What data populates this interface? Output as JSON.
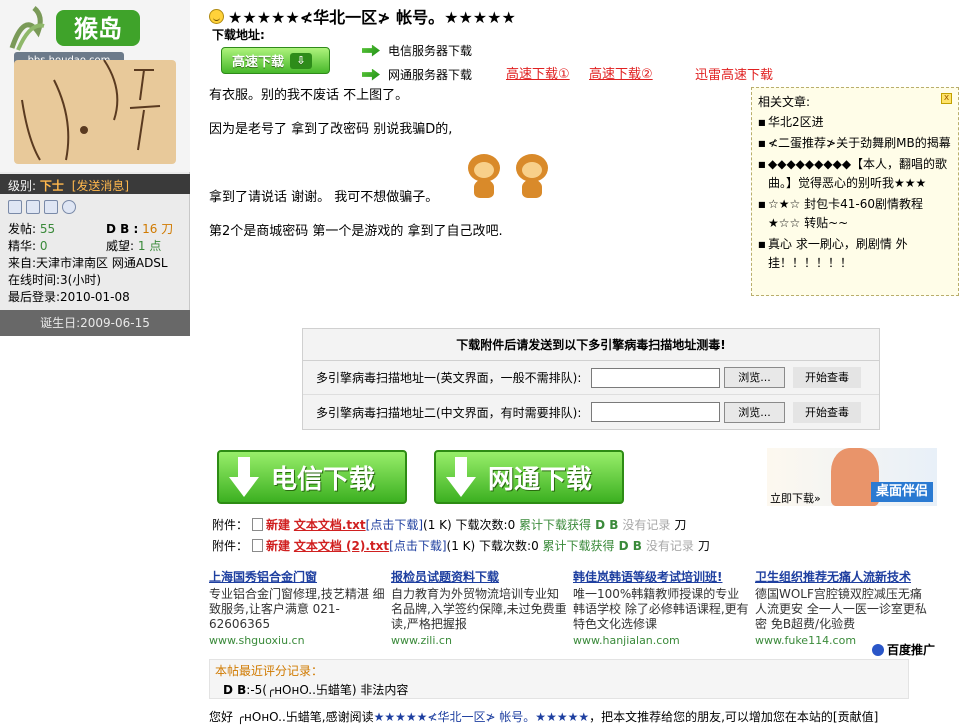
{
  "profile": {
    "logo_text": "猴岛",
    "logo_url": "bbs.houdao.com",
    "level_label": "级别:",
    "level_value": "下士",
    "send_msg": "[发送消息]",
    "posts_label": "发帖:",
    "posts_value": "55",
    "db_label": "D B :",
    "db_value": "16 刀",
    "elite_label": "精华:",
    "elite_value": "0",
    "prestige_label": "威望:",
    "prestige_value": "1 点",
    "from": "来自:天津市津南区 网通ADSL",
    "online": "在线时间:3(小时)",
    "last_login": "最后登录:2010-01-08",
    "birthday": "诞生日:2009-06-15"
  },
  "post": {
    "title": "★★★★★≮华北一区≯ 帐号。★★★★★",
    "download_label": "下载地址:",
    "fast_button": "高速下载",
    "telecom_server": "电信服务器下载",
    "netcom_server": "网通服务器下载",
    "fast_dl_1": "高速下载①",
    "fast_dl_2": "高速下载②",
    "xunlei": "迅雷高速下载",
    "lines": [
      "有衣服。别的我不废话  不上图了。",
      "因为是老号了  拿到了改密码  别说我骗D的,",
      "拿到了请说话  谢谢。  我可不想做骗子。",
      "第2个是商城密码  第一个是游戏的  拿到了自己改吧."
    ]
  },
  "related": {
    "title": "相关文章:",
    "close": "x",
    "items": [
      "华北2区进",
      "≮二蛋推荐≯关于劲舞刷MB的揭幕",
      "◆◆◆◆◆◆◆◆◆【本人，翻唱的歌曲。】觉得恶心的别听我★★★",
      "☆★☆ 封包卡41-60剧情教程★☆☆ 转贴~~",
      "真心  求一刷心，刷剧情  外挂！！！！！！"
    ]
  },
  "scan": {
    "header": "下载附件后请发送到以下多引擎病毒扫描地址测毒!",
    "row1_label": "多引擎病毒扫描地址一(英文界面，一般不需排队):",
    "row2_label": "多引擎病毒扫描地址二(中文界面，有时需要排队):",
    "browse": "浏览...",
    "check": "开始查毒"
  },
  "downloads": {
    "telecom": "电信下载",
    "netcom": "网通下载",
    "ad_cta": "立即下载»",
    "ad_brand": "桌面伴侣"
  },
  "attachments": [
    {
      "prefix": "附件：",
      "new": "新建",
      "name": "文本文档.txt",
      "click": "[点击下载]",
      "size": "(1 K)",
      "count": "下载次数:0",
      "acc": "累计下载获得",
      "db": "D B",
      "norec": "没有记录",
      "unit": "刀"
    },
    {
      "prefix": "附件：",
      "new": "新建",
      "name": "文本文档 (2).txt",
      "click": "[点击下载]",
      "size": "(1 K)",
      "count": "下载次数:0",
      "acc": "累计下载获得",
      "db": "D B",
      "norec": "没有记录",
      "unit": "刀"
    }
  ],
  "ads": [
    {
      "title": "上海国秀铝合金门窗",
      "desc": "专业铝合金门窗修理,技艺精湛  细致服务,让客户满意  021-62606365",
      "url": "www.shguoxiu.cn"
    },
    {
      "title": "报检员试题资料下载",
      "desc": "自力教育为外贸物流培训专业知名品牌,入学签约保障,未过免费重读,严格把握报",
      "url": "www.zili.cn"
    },
    {
      "title": "韩佳岚韩语等级考试培训班!",
      "desc": "唯一100%韩籍教师授课的专业韩语学校  除了必修韩语课程,更有特色文化选修课",
      "url": "www.hanjialan.com"
    },
    {
      "title": "卫生组织推荐无痛人流新技术",
      "desc": "德国WOLF宫腔镜双腔减压无痛人流更安  全一人一医一诊室更私密  免B超费/化验费",
      "url": "www.fuke114.com"
    }
  ],
  "baidu": "百度推广",
  "rating": {
    "header": "本帖最近评分记录：",
    "record_db": "D B",
    "record_rest": ":-5(╭нOнO..卐蜡笔) 非法内容"
  },
  "footer": {
    "prefix": "您好 ╭нOнO..卐蜡笔,感谢阅读",
    "link": "★★★★★≮华北一区≯ 帐号。★★★★★",
    "suffix": "，把本文推荐给您的朋友,可以增加您在本站的[贡献值]"
  },
  "colors": {
    "green_button": "#47b82a",
    "link_red": "#e02020",
    "ad_blue": "#1e3fa0"
  }
}
